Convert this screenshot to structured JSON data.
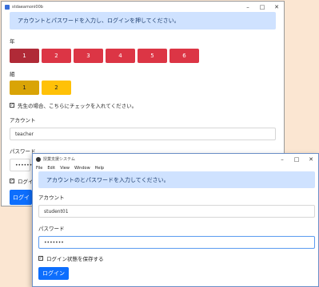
{
  "back_window": {
    "title": "stdaeamoni00b",
    "alert": "アカウントとパスワードを入力し、ログインを押してください。",
    "grade_label": "年",
    "grades": [
      "1",
      "2",
      "3",
      "4",
      "5",
      "6"
    ],
    "class_label": "組",
    "classes": [
      "1",
      "2"
    ],
    "teacher_check_label": "先生の場合、こちらにチェックを入れてください。",
    "account_label": "アカウント",
    "account_value": "teacher",
    "password_label": "パスワード",
    "password_value": "••••••••",
    "remember_label_partial": "ログイ",
    "login_partial": "ログイ"
  },
  "front_window": {
    "title": "授業支援システム",
    "menu": [
      "File",
      "Edit",
      "View",
      "Window",
      "Help"
    ],
    "alert": "アカウントのとパスワードを入力してください。",
    "account_label": "アカウント",
    "account_value": "student01",
    "password_label": "パスワード",
    "password_value": "•••••••",
    "remember_label": "ログイン状態を保存する",
    "login_button": "ログイン"
  },
  "window_controls": {
    "minimize": "–",
    "maximize": "□",
    "close": "✕"
  },
  "colors": {
    "background": "#fbe6d2",
    "red_button": "#dc3545",
    "yellow_button": "#ffc107",
    "primary": "#0d6efd",
    "alert_bg": "#cfe2ff"
  }
}
